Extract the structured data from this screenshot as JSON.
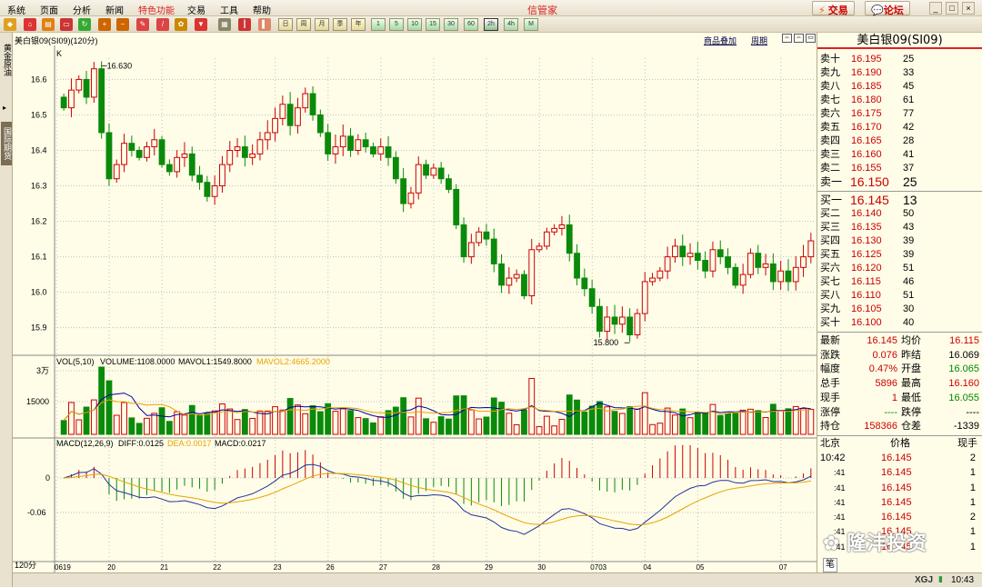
{
  "menu": {
    "items": [
      "系统",
      "页面",
      "分析",
      "新闻",
      "特色功能",
      "交易",
      "工具",
      "帮助"
    ],
    "app_title": "信管家",
    "trade_button": "交易",
    "forum_button": "论坛"
  },
  "toolbar": {
    "period_buttons": [
      "1",
      "5",
      "10",
      "15",
      "30",
      "60",
      "2h",
      "4h",
      "M"
    ],
    "active_period": "2h"
  },
  "sidetabs": [
    "黄金原油",
    "国际期货"
  ],
  "chart_header": {
    "title": "美白银09(SI09)(120分)",
    "product_overlay": "商品叠加",
    "period_link": "周期",
    "k_label": "K"
  },
  "colors": {
    "up": "#cc0000",
    "down": "#0a8a0a",
    "grid": "#c0c0c0",
    "mavol1": "#0000aa",
    "mavol2": "#e6a300",
    "diff": "#223399",
    "dea": "#e6a300"
  },
  "chart_data": {
    "type": "candlestick",
    "price_ylim": [
      15.83,
      16.66
    ],
    "price_ticks": [
      "16.6",
      "16.5",
      "16.4",
      "16.3",
      "16.2",
      "16.1",
      "16.0",
      "15.9"
    ],
    "high_label": "16.630",
    "low_label": "15.800",
    "x_ticks": [
      "0619",
      "20",
      "21",
      "22",
      "23",
      "26",
      "27",
      "28",
      "29",
      "30",
      "0703",
      "04",
      "05",
      "07"
    ],
    "x_axis_corner": "120分",
    "volume": {
      "label": "VOL(5,10)",
      "volume_text": "VOLUME:1108.0000",
      "mavol1_text": "MAVOL1:1549.8000",
      "mavol2_text": "MAVOL2:4665.2000",
      "ticks": [
        "3万",
        "15000"
      ]
    },
    "macd": {
      "label": "MACD(12,26,9)",
      "diff_text": "DIFF:0.0125",
      "dea_text": "DEA:0.0017",
      "macd_text": "MACD:0.0217",
      "ticks": [
        "0",
        "-0.06"
      ]
    },
    "closes": [
      16.52,
      16.57,
      16.6,
      16.55,
      16.63,
      16.45,
      16.32,
      16.36,
      16.42,
      16.4,
      16.38,
      16.41,
      16.43,
      16.36,
      16.34,
      16.38,
      16.39,
      16.33,
      16.31,
      16.27,
      16.3,
      16.36,
      16.4,
      16.41,
      16.38,
      16.39,
      16.43,
      16.45,
      16.49,
      16.53,
      16.47,
      16.52,
      16.56,
      16.5,
      16.45,
      16.39,
      16.41,
      16.44,
      16.4,
      16.43,
      16.41,
      16.39,
      16.41,
      16.38,
      16.32,
      16.25,
      16.28,
      16.36,
      16.33,
      16.35,
      16.32,
      16.29,
      16.19,
      16.1,
      16.14,
      16.17,
      16.15,
      16.08,
      16.02,
      16.04,
      16.05,
      15.99,
      16.12,
      16.13,
      16.17,
      16.18,
      16.19,
      16.11,
      16.04,
      16.01,
      15.96,
      15.89,
      15.93,
      15.91,
      15.93,
      15.88,
      15.94,
      16.03,
      16.04,
      16.06,
      16.1,
      16.13,
      16.1,
      16.11,
      16.09,
      16.06,
      16.12,
      16.1,
      16.07,
      16.02,
      16.05,
      16.11,
      16.07,
      16.08,
      16.03,
      16.06,
      16.03,
      16.07,
      16.1,
      16.145
    ]
  },
  "quote": {
    "title": "美白银09(SI09)",
    "asks": [
      {
        "label": "卖十",
        "price": "16.195",
        "vol": "25"
      },
      {
        "label": "卖九",
        "price": "16.190",
        "vol": "33"
      },
      {
        "label": "卖八",
        "price": "16.185",
        "vol": "45"
      },
      {
        "label": "卖七",
        "price": "16.180",
        "vol": "61"
      },
      {
        "label": "卖六",
        "price": "16.175",
        "vol": "77"
      },
      {
        "label": "卖五",
        "price": "16.170",
        "vol": "42"
      },
      {
        "label": "卖四",
        "price": "16.165",
        "vol": "28"
      },
      {
        "label": "卖三",
        "price": "16.160",
        "vol": "41"
      },
      {
        "label": "卖二",
        "price": "16.155",
        "vol": "37"
      },
      {
        "label": "卖一",
        "price": "16.150",
        "vol": "25"
      }
    ],
    "bids": [
      {
        "label": "买一",
        "price": "16.145",
        "vol": "13"
      },
      {
        "label": "买二",
        "price": "16.140",
        "vol": "50"
      },
      {
        "label": "买三",
        "price": "16.135",
        "vol": "43"
      },
      {
        "label": "买四",
        "price": "16.130",
        "vol": "39"
      },
      {
        "label": "买五",
        "price": "16.125",
        "vol": "39"
      },
      {
        "label": "买六",
        "price": "16.120",
        "vol": "51"
      },
      {
        "label": "买七",
        "price": "16.115",
        "vol": "46"
      },
      {
        "label": "买八",
        "price": "16.110",
        "vol": "51"
      },
      {
        "label": "买九",
        "price": "16.105",
        "vol": "30"
      },
      {
        "label": "买十",
        "price": "16.100",
        "vol": "40"
      }
    ],
    "stats": [
      {
        "l1": "最新",
        "v1": "16.145",
        "l2": "均价",
        "v2": "16.115"
      },
      {
        "l1": "涨跌",
        "v1": "0.076",
        "l2": "昨结",
        "v2": "16.069"
      },
      {
        "l1": "幅度",
        "v1": "0.47%",
        "l2": "开盘",
        "v2": "16.065"
      },
      {
        "l1": "总手",
        "v1": "5896",
        "l2": "最高",
        "v2": "16.160"
      },
      {
        "l1": "现手",
        "v1": "1",
        "l2": "最低",
        "v2": "16.055"
      },
      {
        "l1": "涨停",
        "v1": "----",
        "l2": "跌停",
        "v2": "----"
      },
      {
        "l1": "持仓",
        "v1": "158366",
        "l2": "仓差",
        "v2": "-1339"
      }
    ],
    "ticks_header": {
      "time": "北京",
      "price": "价格",
      "vol": "现手"
    },
    "ticks": [
      {
        "time": "10:42",
        "price": "16.145",
        "vol": "2"
      },
      {
        "time": ":41",
        "price": "16.145",
        "vol": "1"
      },
      {
        "time": ":41",
        "price": "16.145",
        "vol": "1"
      },
      {
        "time": ":41",
        "price": "16.145",
        "vol": "1"
      },
      {
        "time": ":41",
        "price": "16.145",
        "vol": "2"
      },
      {
        "time": ":41",
        "price": "16.145",
        "vol": "1"
      },
      {
        "time": ":41",
        "price": "16.145",
        "vol": "1"
      }
    ],
    "bottom_tab": "笔"
  },
  "watermark": "隆沣投资",
  "status": {
    "brand": "XGJ",
    "time": "10:43"
  }
}
